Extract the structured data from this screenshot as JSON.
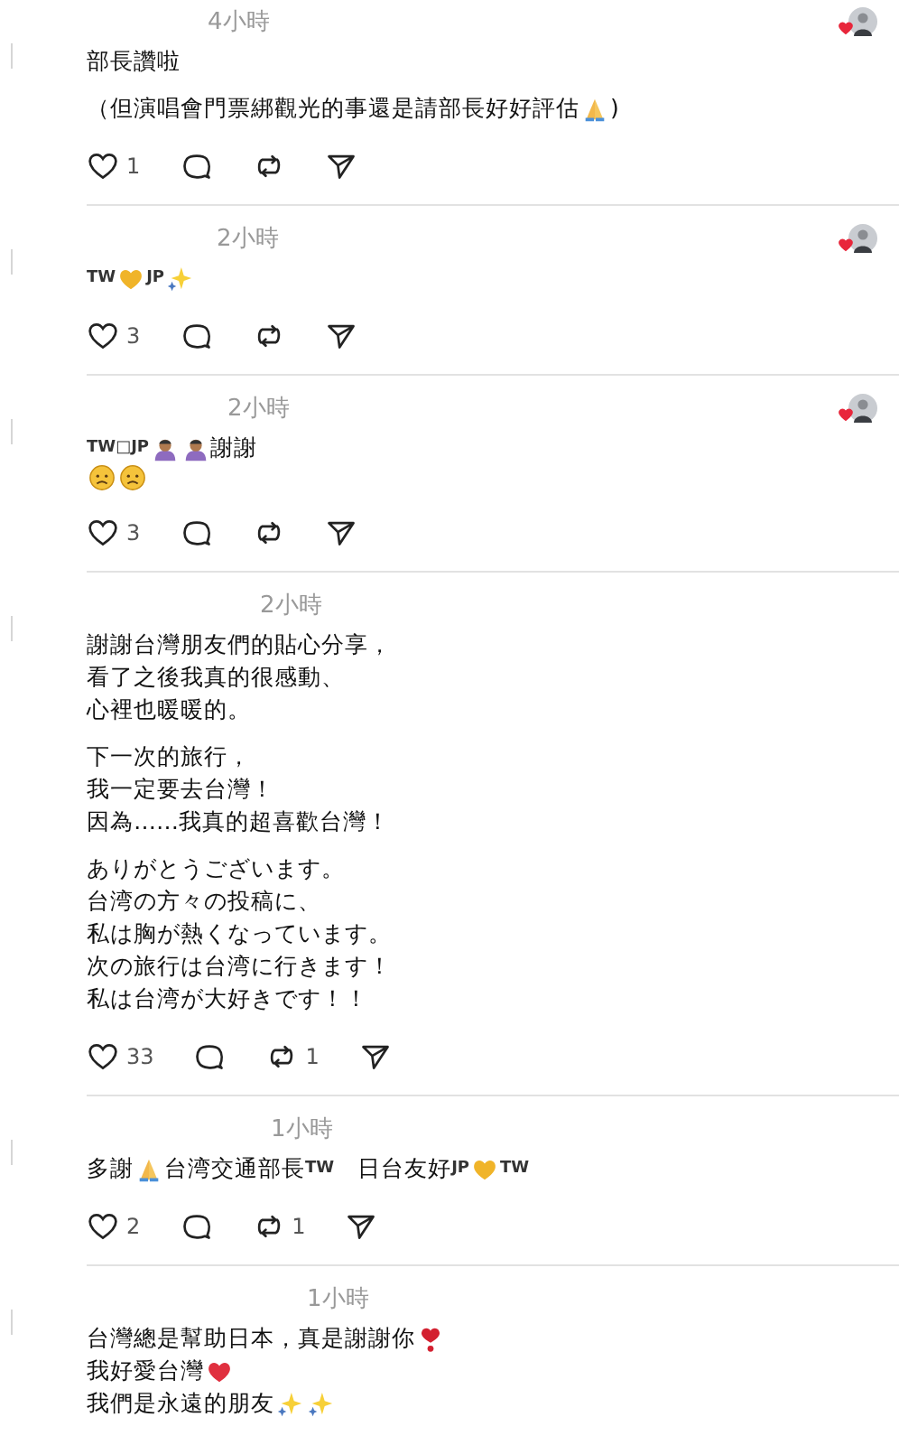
{
  "posts": [
    {
      "time": "4小時",
      "liked_by_author": true,
      "body": [
        [
          [
            "部長讚啦"
          ]
        ],
        [
          [
            "（但演唱會門票綁觀光的事還是請部長好好評估",
            {
              "kind": "pray"
            },
            ")"
          ]
        ]
      ],
      "likes": "1"
    },
    {
      "time": "2小時",
      "liked_by_author": true,
      "body": [
        [
          [
            {
              "kind": "flag",
              "text": "TW"
            },
            {
              "kind": "yellow_heart"
            },
            {
              "kind": "flag",
              "text": "JP"
            },
            {
              "kind": "sparkles"
            }
          ]
        ]
      ],
      "likes": "3"
    },
    {
      "time": "2小時",
      "liked_by_author": true,
      "body": [
        [
          [
            {
              "kind": "flag",
              "text": "TW□JP"
            },
            {
              "kind": "bowing_person"
            },
            {
              "kind": "bowing_person"
            },
            "謝謝"
          ],
          [
            {
              "kind": "frown"
            },
            {
              "kind": "frown"
            }
          ]
        ]
      ],
      "likes": "3"
    },
    {
      "time": "2小時",
      "liked_by_author": false,
      "body": [
        [
          [
            "謝謝台灣朋友們的貼心分享，"
          ],
          [
            "看了之後我真的很感動、"
          ],
          [
            "心裡也暖暖的。"
          ]
        ],
        [
          [
            "下一次的旅行，"
          ],
          [
            "我一定要去台灣！"
          ],
          [
            "因為……我真的超喜歡台灣！"
          ]
        ],
        [
          [
            "ありがとうございます。"
          ],
          [
            "台湾の方々の投稿に、"
          ],
          [
            "私は胸が熱くなっています。"
          ],
          [
            "次の旅行は台湾に行きます！"
          ],
          [
            "私は台湾が大好きです！！"
          ]
        ]
      ],
      "likes": "33",
      "reposts": "1"
    },
    {
      "time": "1小時",
      "liked_by_author": false,
      "body": [
        [
          [
            "多謝",
            {
              "kind": "pray"
            },
            "台湾交通部長",
            {
              "kind": "flag",
              "text": "TW"
            },
            "　日台友好",
            {
              "kind": "flag",
              "text": "JP"
            },
            {
              "kind": "yellow_heart"
            },
            {
              "kind": "flag",
              "text": "TW"
            }
          ]
        ]
      ],
      "likes": "2",
      "reposts": "1"
    },
    {
      "time": "1小時",
      "liked_by_author": false,
      "body": [
        [
          [
            "台灣總是幫助日本，真是謝謝你",
            {
              "kind": "heart_exclamation"
            }
          ],
          [
            "我好愛台灣",
            {
              "kind": "red_heart"
            }
          ],
          [
            "我們是永遠的朋友",
            {
              "kind": "sparkles"
            },
            {
              "kind": "sparkles"
            }
          ]
        ]
      ]
    }
  ]
}
